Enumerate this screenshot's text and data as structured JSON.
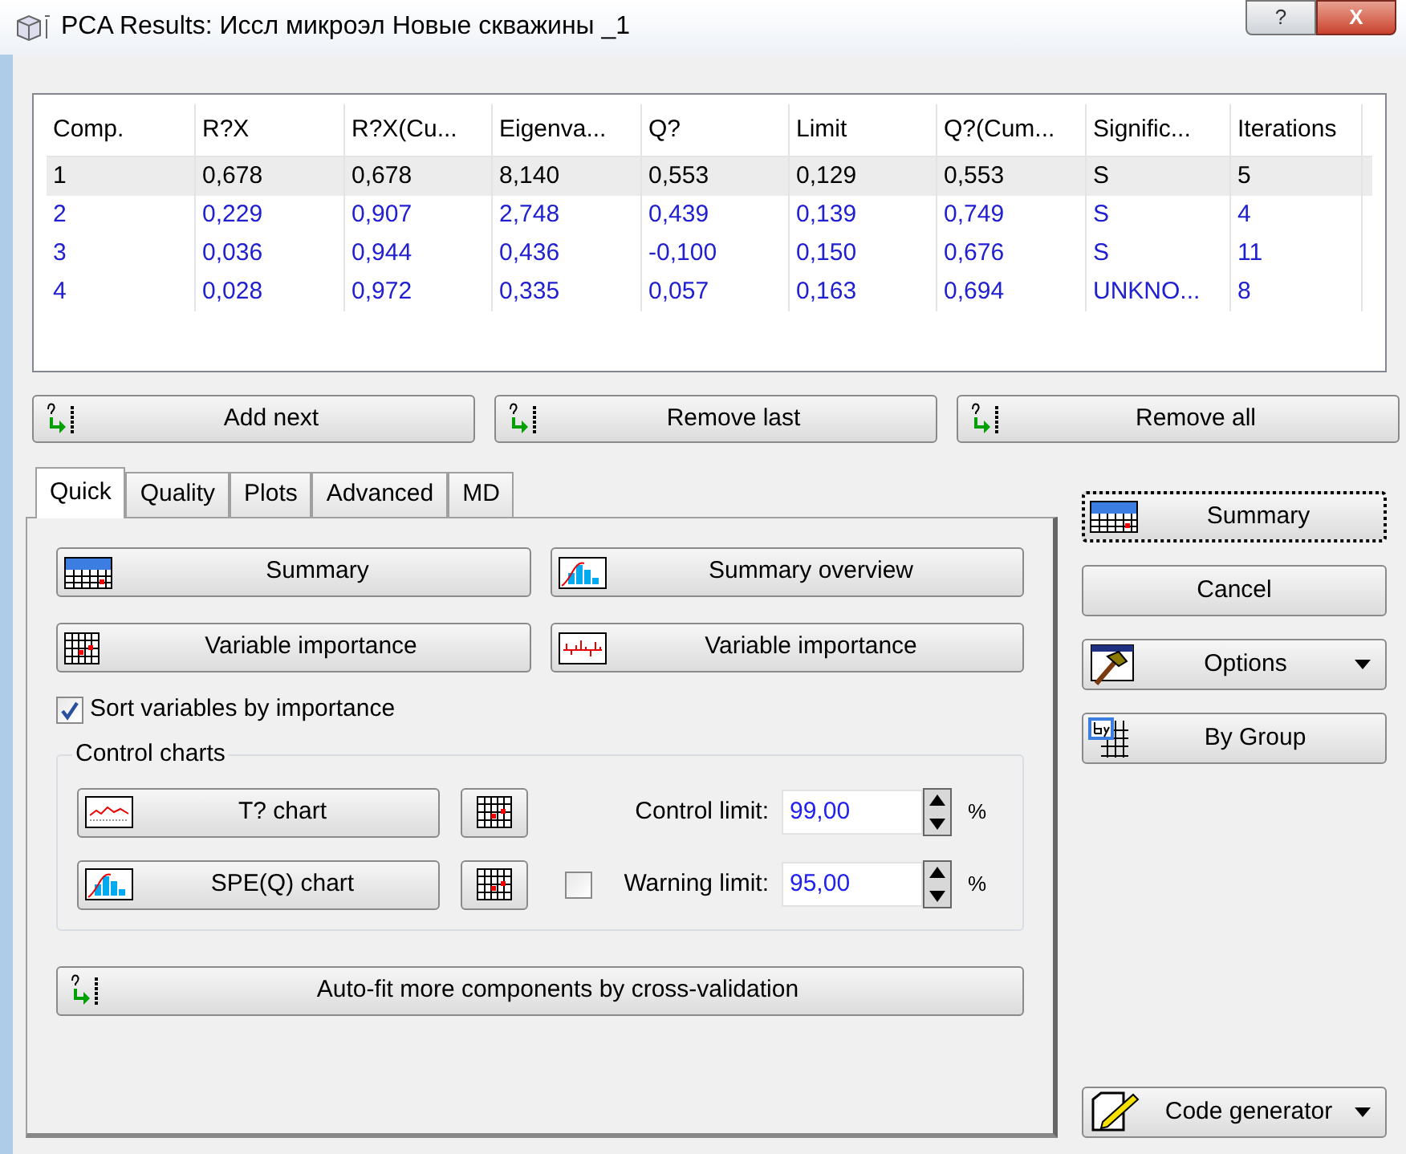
{
  "window": {
    "title": "PCA Results: Иссл микроэл Новые скважины _1",
    "help": "?",
    "close": "X"
  },
  "table": {
    "columns": [
      "Comp.",
      "R?X",
      "R?X(Cu...",
      "Eigenva...",
      "Q?",
      "Limit",
      "Q?(Cum...",
      "Signific...",
      "Iterations"
    ],
    "rows": [
      {
        "selected": true,
        "cells": [
          "1",
          "0,678",
          "0,678",
          "8,140",
          "0,553",
          "0,129",
          "0,553",
          "S",
          "5"
        ]
      },
      {
        "selected": false,
        "cells": [
          "2",
          "0,229",
          "0,907",
          "2,748",
          "0,439",
          "0,139",
          "0,749",
          "S",
          "4"
        ]
      },
      {
        "selected": false,
        "cells": [
          "3",
          "0,036",
          "0,944",
          "0,436",
          "-0,100",
          "0,150",
          "0,676",
          "S",
          "11"
        ]
      },
      {
        "selected": false,
        "cells": [
          "4",
          "0,028",
          "0,972",
          "0,335",
          "0,057",
          "0,163",
          "0,694",
          "UNKNO...",
          "8"
        ]
      }
    ]
  },
  "component_buttons": [
    "Add next",
    "Remove last",
    "Remove all"
  ],
  "tabs": [
    {
      "label": "Quick",
      "selected": true
    },
    {
      "label": "Quality",
      "selected": false
    },
    {
      "label": "Plots",
      "selected": false
    },
    {
      "label": "Advanced",
      "selected": false
    },
    {
      "label": "MD",
      "selected": false
    }
  ],
  "quick": {
    "buttons": [
      {
        "label": "Summary",
        "kind": "summary"
      },
      {
        "label": "Summary overview",
        "kind": "histogram"
      },
      {
        "label": "Variable importance",
        "kind": "grid"
      },
      {
        "label": "Variable importance",
        "kind": "spikes"
      }
    ],
    "sort_checkbox": {
      "label": "Sort variables by importance",
      "checked": true
    },
    "control_charts": {
      "title": "Control charts",
      "t_chart": "T? chart",
      "spe_chart": "SPE(Q) chart",
      "control_limit": {
        "label": "Control limit:",
        "value": "99,00",
        "unit": "%"
      },
      "warning_limit": {
        "label": "Warning limit:",
        "value": "95,00",
        "unit": "%",
        "checked": false
      }
    },
    "autofit": "Auto-fit more components by cross-validation"
  },
  "side_buttons": [
    {
      "label": "Summary",
      "kind": "summary",
      "focused": true,
      "dropdown": false
    },
    {
      "label": "Cancel",
      "kind": "none",
      "focused": false,
      "dropdown": false
    },
    {
      "label": "Options",
      "kind": "hammer",
      "focused": false,
      "dropdown": true
    },
    {
      "label": "By Group",
      "kind": "bygroup",
      "focused": false,
      "dropdown": false
    }
  ],
  "code_generator": {
    "label": "Code generator",
    "dropdown": true
  }
}
